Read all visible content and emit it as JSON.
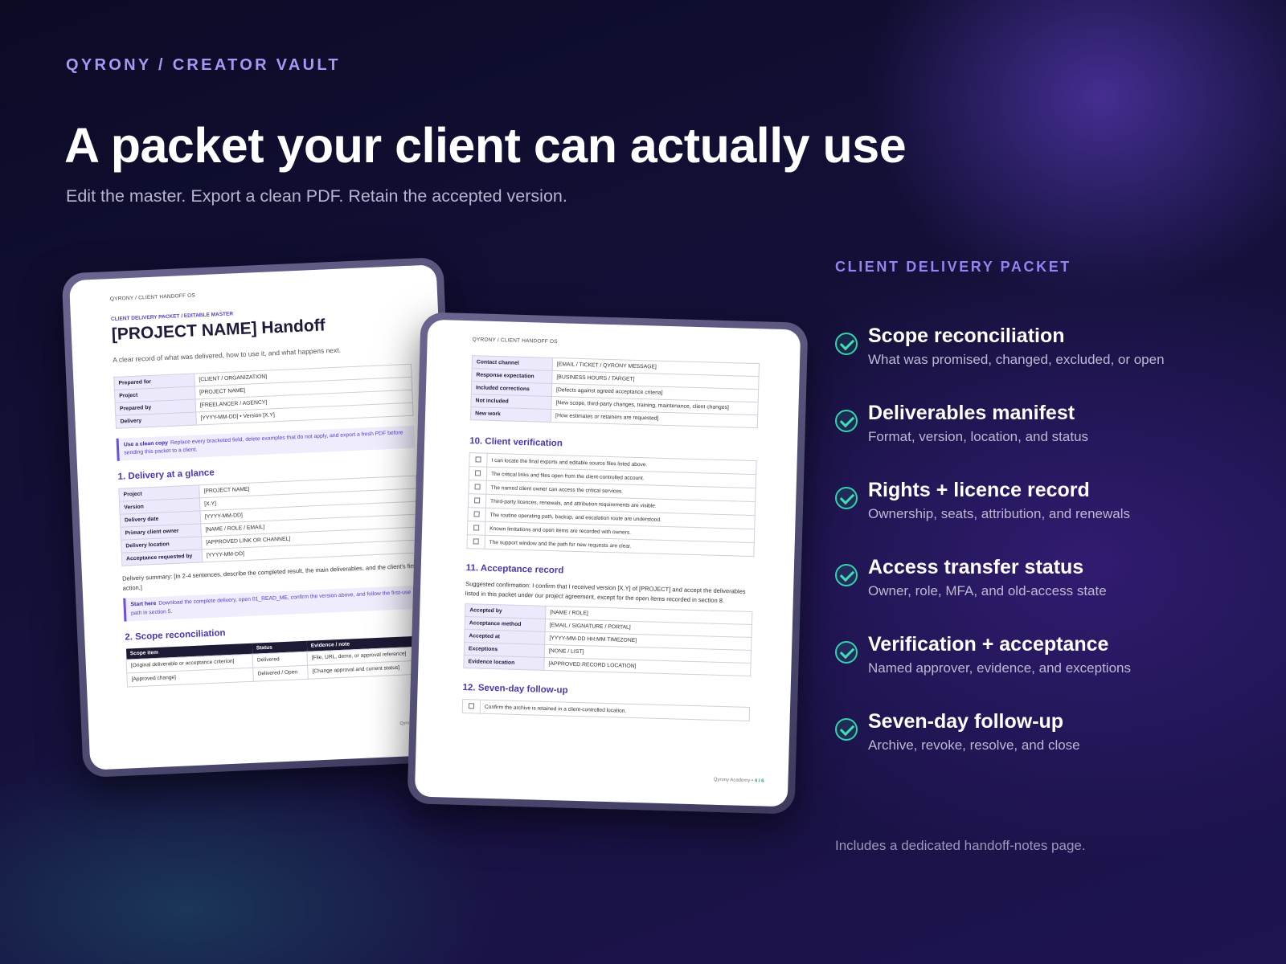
{
  "eyebrow": "QYRONY / CREATOR VAULT",
  "headline": "A packet your client can actually use",
  "subhead": "Edit the master. Export a clean PDF. Retain the accepted version.",
  "doc_a": {
    "crumb": "QYRONY / CLIENT HANDOFF OS",
    "eyebrow": "CLIENT DELIVERY PACKET / EDITABLE MASTER",
    "title": "[PROJECT NAME] Handoff",
    "desc": "A clear record of what was delivered, how to use it, and what happens next.",
    "meta": [
      {
        "k": "Prepared for",
        "v": "[CLIENT / ORGANIZATION]"
      },
      {
        "k": "Project",
        "v": "[PROJECT NAME]"
      },
      {
        "k": "Prepared by",
        "v": "[FREELANCER / AGENCY]"
      },
      {
        "k": "Delivery",
        "v": "[YYYY-MM-DD] • Version [X.Y]"
      }
    ],
    "note1": {
      "label": "Use a clean copy",
      "text": "Replace every bracketed field, delete examples that do not apply, and export a fresh PDF before sending this packet to a client."
    },
    "section1": "1. Delivery at a glance",
    "glance": [
      {
        "k": "Project",
        "v": "[PROJECT NAME]"
      },
      {
        "k": "Version",
        "v": "[X.Y]"
      },
      {
        "k": "Delivery date",
        "v": "[YYYY-MM-DD]"
      },
      {
        "k": "Primary client owner",
        "v": "[NAME / ROLE / EMAIL]"
      },
      {
        "k": "Delivery location",
        "v": "[APPROVED LINK OR CHANNEL]"
      },
      {
        "k": "Acceptance requested by",
        "v": "[YYYY-MM-DD]"
      }
    ],
    "summary": "Delivery summary: [In 2-4 sentences, describe the completed result, the main deliverables, and the client's first action.]",
    "note2": {
      "label": "Start here",
      "text": "Download the complete delivery, open 01_READ_ME, confirm the version above, and follow the first-use path in section 5."
    },
    "section2": "2. Scope reconciliation",
    "scope_headers": [
      "Scope item",
      "Status",
      "Evidence / note"
    ],
    "scope_rows": [
      [
        "[Original deliverable or acceptance criterion]",
        "Delivered",
        "[File, URL, demo, or approval reference]"
      ],
      [
        "[Approved change]",
        "Delivered / Open",
        "[Change approval and current status]"
      ]
    ],
    "footer": "Qyrony Academy • 1"
  },
  "doc_b": {
    "crumb": "QYRONY / CLIENT HANDOFF OS",
    "support": [
      {
        "k": "Contact channel",
        "v": "[EMAIL / TICKET / QYRONY MESSAGE]"
      },
      {
        "k": "Response expectation",
        "v": "[BUSINESS HOURS / TARGET]"
      },
      {
        "k": "Included corrections",
        "v": "[Defects against agreed acceptance criteria]"
      },
      {
        "k": "Not included",
        "v": "[New scope, third-party changes, training, maintenance, client changes]"
      },
      {
        "k": "New work",
        "v": "[How estimates or retainers are requested]"
      }
    ],
    "section10": "10. Client verification",
    "verification": [
      "I can locate the final exports and editable source files listed above.",
      "The critical links and files open from the client-controlled account.",
      "The named client owner can access the critical services.",
      "Third-party licences, renewals, and attribution requirements are visible.",
      "The routine operating path, backup, and escalation route are understood.",
      "Known limitations and open items are recorded with owners.",
      "The support window and the path for new requests are clear."
    ],
    "section11": "11. Acceptance record",
    "confirmation": "Suggested confirmation: I confirm that I received version [X.Y] of [PROJECT] and accept the deliverables listed in this packet under our project agreement, except for the open items recorded in section 8.",
    "acceptance": [
      {
        "k": "Accepted by",
        "v": "[NAME / ROLE]"
      },
      {
        "k": "Acceptance method",
        "v": "[EMAIL / SIGNATURE / PORTAL]"
      },
      {
        "k": "Accepted at",
        "v": "[YYYY-MM-DD HH:MM TIMEZONE]"
      },
      {
        "k": "Exceptions",
        "v": "[NONE / LIST]"
      },
      {
        "k": "Evidence location",
        "v": "[APPROVED RECORD LOCATION]"
      }
    ],
    "section12": "12. Seven-day follow-up",
    "followup": [
      "Confirm the archive is retained in a client-controlled location."
    ],
    "footer_brand": "Qyrony Academy •",
    "footer_page": "4 / 6"
  },
  "panel": {
    "title": "CLIENT DELIVERY PACKET",
    "features": [
      {
        "title": "Scope reconciliation",
        "desc": "What was promised, changed, excluded, or open"
      },
      {
        "title": "Deliverables manifest",
        "desc": "Format, version, location, and status"
      },
      {
        "title": "Rights + licence record",
        "desc": "Ownership, seats, attribution, and renewals"
      },
      {
        "title": "Access transfer status",
        "desc": "Owner, role, MFA, and old-access state"
      },
      {
        "title": "Verification + acceptance",
        "desc": "Named approver, evidence, and exceptions"
      },
      {
        "title": "Seven-day follow-up",
        "desc": "Archive, revoke, resolve, and close"
      }
    ],
    "check_icon": "check-circle-icon",
    "closing": "Includes a dedicated handoff-notes page."
  },
  "colors": {
    "accent": "#9483f0",
    "check": "#3ee0b4",
    "doc_heading": "#4a36b8"
  }
}
